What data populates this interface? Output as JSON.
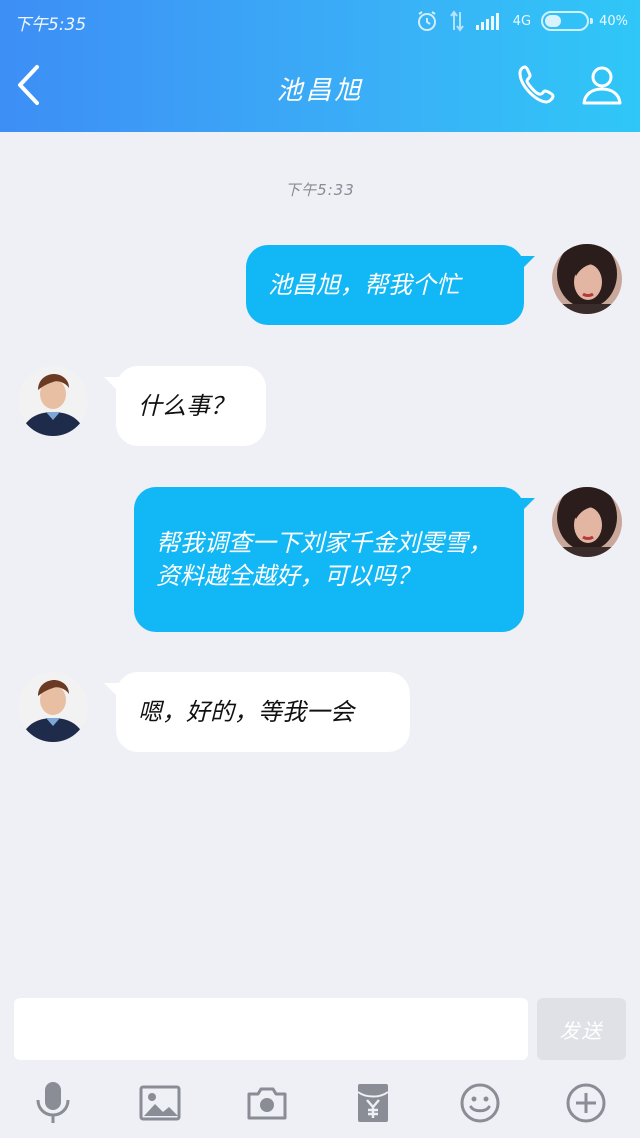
{
  "status_bar": {
    "time": "下午5:35",
    "network": "4G",
    "battery_percent": "40%",
    "battery_level": 0.4
  },
  "header": {
    "title": "池昌旭",
    "back_icon": "chevron-left-icon",
    "call_icon": "phone-icon",
    "profile_icon": "person-icon"
  },
  "chat": {
    "timestamp": "下午5:33",
    "messages": [
      {
        "direction": "out",
        "text": "池昌旭，帮我个忙"
      },
      {
        "direction": "in",
        "text": "什么事？"
      },
      {
        "direction": "out",
        "text": "帮我调查一下刘家千金刘雯雪，资料越全越好，可以吗？"
      },
      {
        "direction": "in",
        "text": "嗯，好的，等我一会"
      }
    ]
  },
  "composer": {
    "input_value": "",
    "send_label": "发送"
  },
  "toolbar": {
    "icons": [
      "microphone-icon",
      "image-icon",
      "camera-icon",
      "red-packet-icon",
      "emoji-icon",
      "plus-icon"
    ]
  },
  "colors": {
    "header_gradient_start": "#3d8ef5",
    "header_gradient_end": "#2fc7f7",
    "outgoing_bubble": "#12b7f5",
    "incoming_bubble": "#ffffff",
    "background": "#eef0f6",
    "icon_gray": "#8a8d96"
  }
}
